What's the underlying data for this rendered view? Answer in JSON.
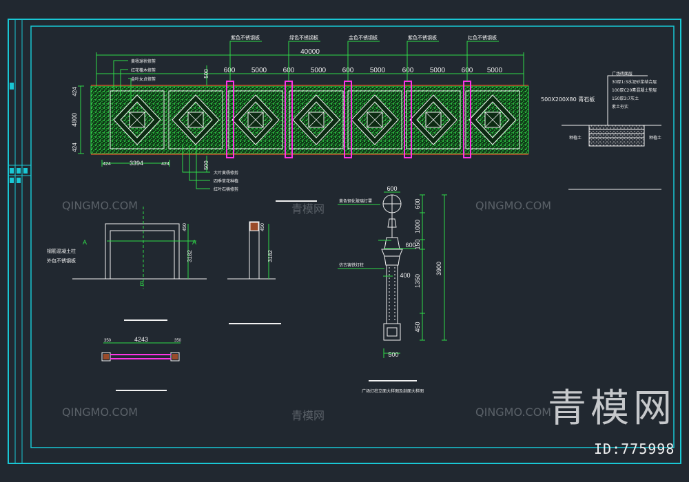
{
  "colors": {
    "background": "#212830",
    "frame": "#19c7d4",
    "hedge": "#22c23a",
    "dimension": "#2fdc49",
    "pillar": "#ff33e6",
    "text": "#f2f2f2",
    "brick": "#9a4b2a"
  },
  "plan": {
    "overall_dim": "40000",
    "segment_dims": [
      "600",
      "5000",
      "600",
      "5000",
      "600",
      "5000",
      "600",
      "5000",
      "600",
      "5000"
    ],
    "left_dim": "3394",
    "height_dim": "4800",
    "height_small_top": "424",
    "height_small_bottom": "424",
    "small_dim_a": "424",
    "small_dim_b": "424",
    "vertical_500_top": "500",
    "vertical_500_bottom": "500",
    "steel_labels": [
      "紫色不锈钢板",
      "绿色不锈钢板",
      "金色不锈钢板",
      "紫色不锈钢板",
      "红色不锈钢板"
    ],
    "left_notes": [
      "黄杨球状修剪",
      "红花檵木修剪",
      "金叶女贞修剪"
    ],
    "bottom_notes": [
      "大叶黄杨修剪",
      "四季草花种植",
      "红叶石楠修剪"
    ]
  },
  "section": {
    "dim_top": "500X200X80 青石板",
    "notes": [
      "广场砖面层",
      "30厚1:3水泥砂浆结合层",
      "100厚C20素混凝土垫层",
      "150厚3:7灰土",
      "素土夯实"
    ],
    "left_label": "种植土",
    "right_label": "种植土"
  },
  "gate": {
    "note1": "钢筋混凝土柱",
    "note2": "外包不锈钢板",
    "marker_a": "A",
    "marker_b": "B",
    "dim_height_left": "3182",
    "dim_height_right": "3182",
    "dim_top_right": "450",
    "dim_mid_right": "450"
  },
  "plan_small": {
    "dim_total": "4243",
    "dim_left": "350",
    "dim_right": "350"
  },
  "lamp": {
    "dim_top": "600",
    "dim_mid": "600",
    "dim_base": "500",
    "dim_400": "400",
    "dim_total": "3900",
    "dim_parts": [
      "600",
      "1000",
      "150",
      "1350",
      "450"
    ],
    "note1": "黄色钢化玻璃灯罩",
    "note2": "仿古铸铁灯柱",
    "caption": "广场灯柱立面大样图及剖面大样图"
  },
  "watermarks": {
    "qingmo": "QINGMO.COM",
    "brand_cn": "青模网",
    "big": "青模网",
    "id": "ID:775998"
  }
}
